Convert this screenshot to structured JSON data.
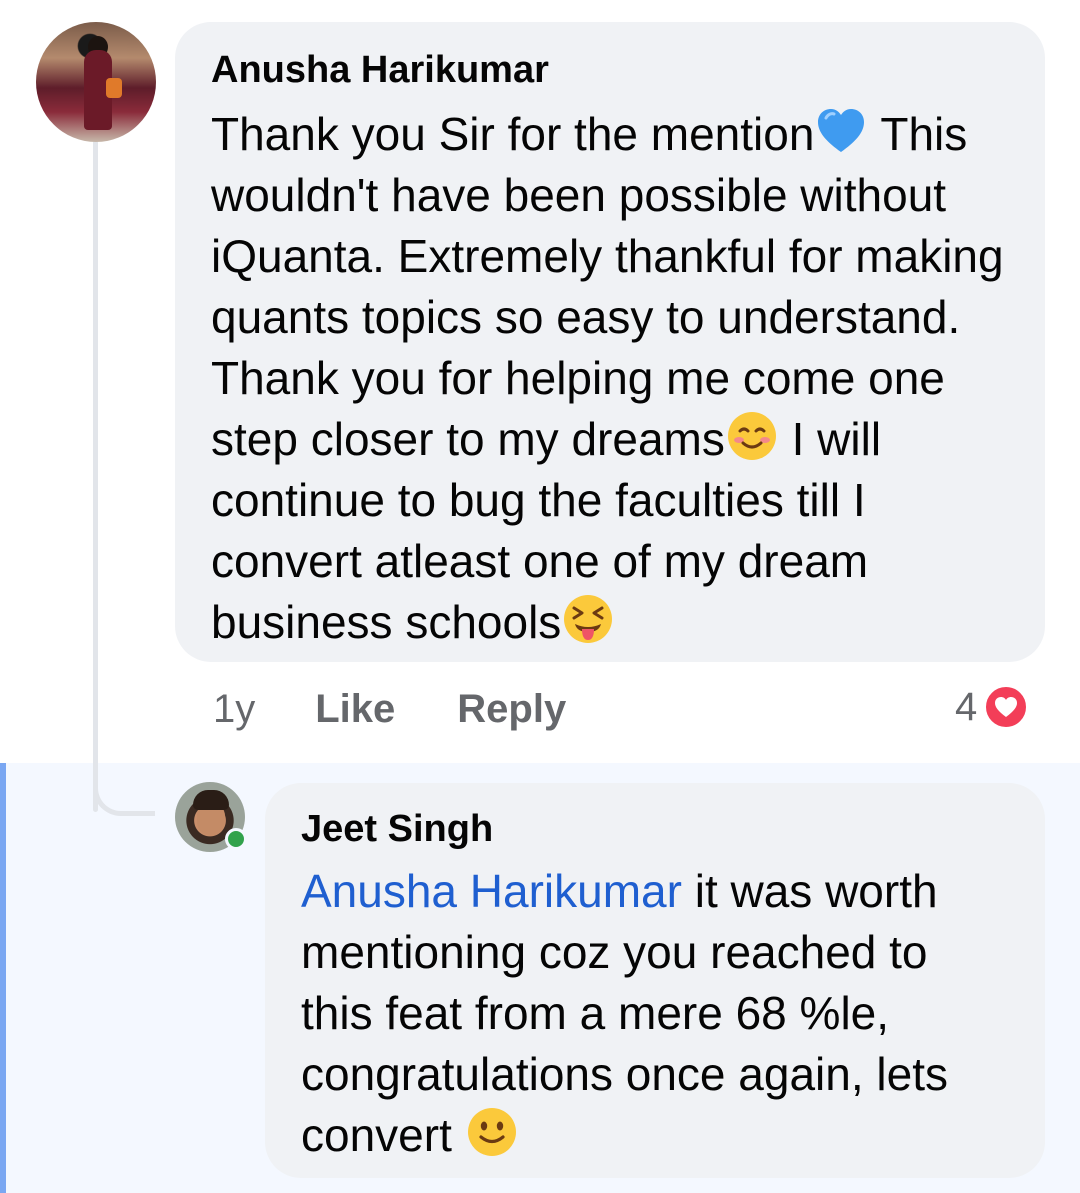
{
  "comment": {
    "author": "Anusha Harikumar",
    "text_1": "Thank you Sir for the mention",
    "emoji_1": "blue-heart-icon",
    "text_2": " This wouldn't have been possible without iQuanta. Extremely thankful for making quants topics so easy to understand. Thank you for helping me come one step closer to my dreams",
    "emoji_2": "smiling-face-icon",
    "text_3": " I will continue to bug the faculties till I convert atleast one of my dream business schools",
    "emoji_3": "squinting-tongue-face-icon",
    "time": "1y",
    "like_label": "Like",
    "reply_label": "Reply",
    "reaction_count": "4",
    "reaction_icon": "love-reaction-icon"
  },
  "reply": {
    "author": "Jeet Singh",
    "mention": "Anusha Harikumar",
    "text": " it was worth mentioning coz you reached to this feat from a mere 68 %le, congratulations once again, lets convert ",
    "emoji": "slightly-smiling-face-icon",
    "online": true
  },
  "colors": {
    "bubble": "#f0f2f5",
    "mention": "#1f5fd0",
    "meta": "#65676b",
    "love_reaction": "#f33e58",
    "online_dot": "#31a24c",
    "highlight": "#f4f8ff"
  }
}
